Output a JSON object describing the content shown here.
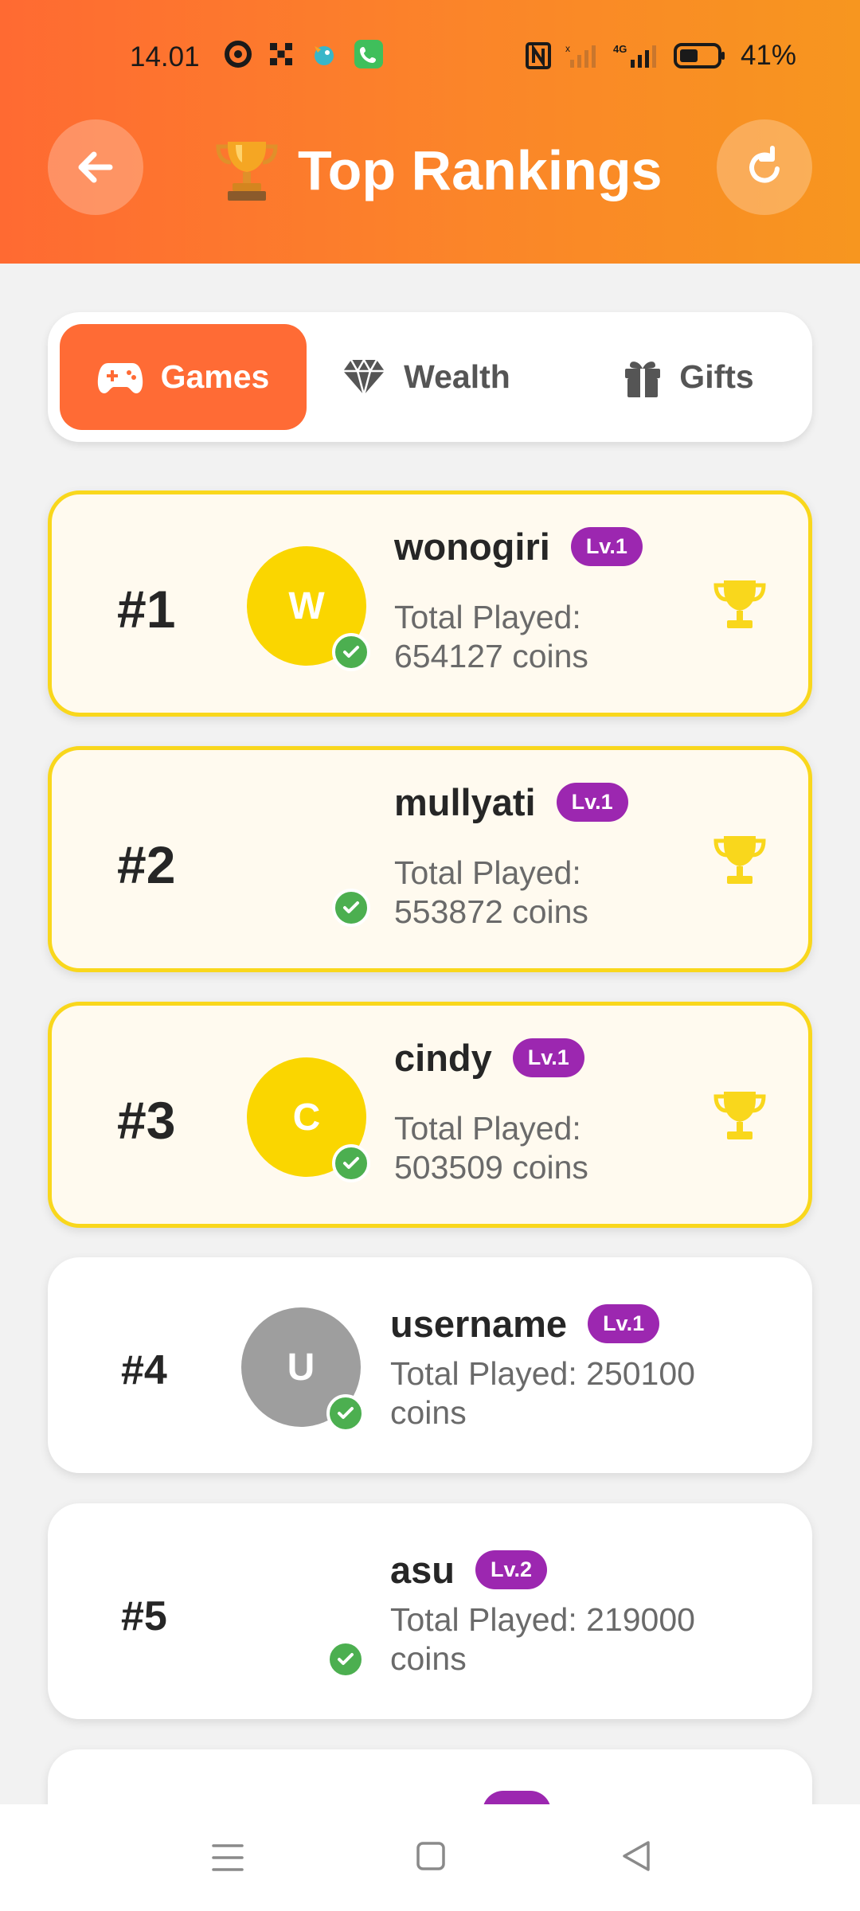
{
  "status_bar": {
    "time": "14.01",
    "battery": "41%"
  },
  "header": {
    "title": "Top Rankings"
  },
  "tabs": [
    {
      "label": "Games",
      "icon": "gamepad-icon"
    },
    {
      "label": "Wealth",
      "icon": "diamond-icon"
    },
    {
      "label": "Gifts",
      "icon": "gift-icon"
    }
  ],
  "rankings": [
    {
      "rank": "#1",
      "name": "wonogiri",
      "level": "Lv.1",
      "initial": "W",
      "played": "Total Played: 654127 coins"
    },
    {
      "rank": "#2",
      "name": "mullyati",
      "level": "Lv.1",
      "initial": "",
      "played": "Total Played: 553872 coins"
    },
    {
      "rank": "#3",
      "name": "cindy",
      "level": "Lv.1",
      "initial": "C",
      "played": "Total Played: 503509 coins"
    },
    {
      "rank": "#4",
      "name": "username",
      "level": "Lv.1",
      "initial": "U",
      "played": "Total Played: 250100 coins"
    },
    {
      "rank": "#5",
      "name": "asu",
      "level": "Lv.2",
      "initial": "",
      "played": "Total Played: 219000 coins"
    }
  ],
  "colors": {
    "accent": "#ff6b35",
    "gold": "#f9d71c",
    "level_badge": "#9c27b0",
    "verified": "#4caf50",
    "avatar_default": "#9e9e9e"
  }
}
